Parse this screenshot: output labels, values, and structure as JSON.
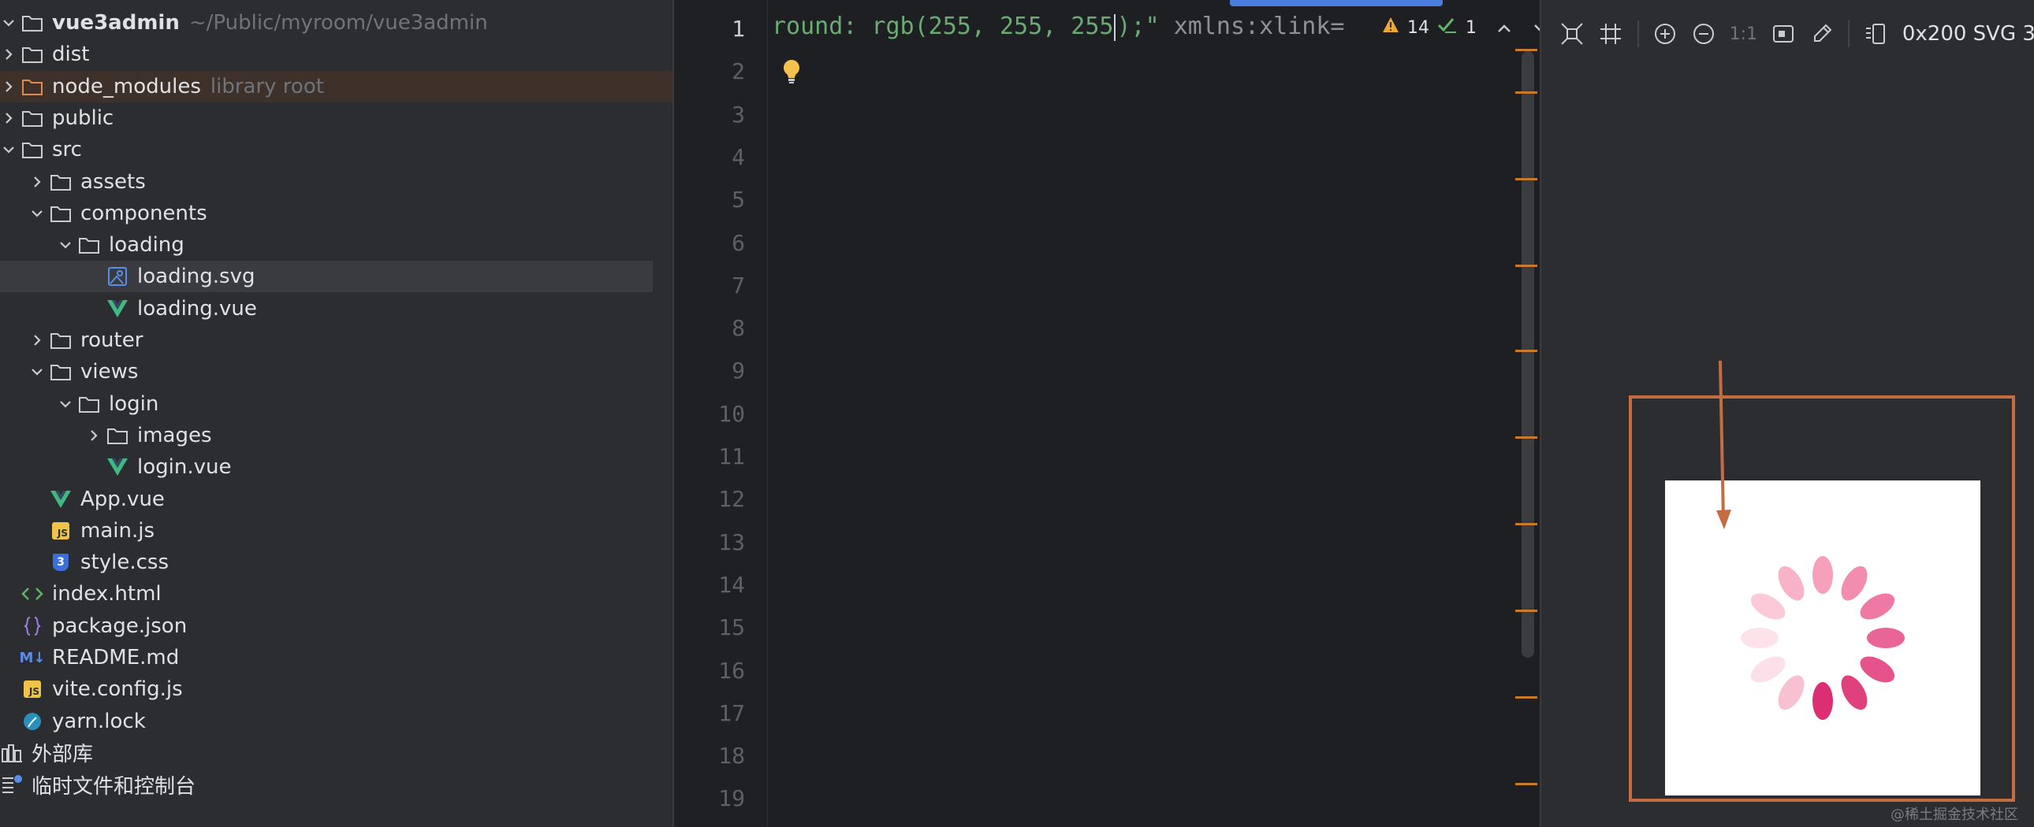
{
  "tree": {
    "items": [
      {
        "label": "vue3admin",
        "hint": "~/Public/myroom/vue3admin",
        "indent": 0,
        "icon": "folder",
        "expanded": true,
        "bold": true
      },
      {
        "label": "dist",
        "indent": 0,
        "icon": "folder",
        "expanded": false
      },
      {
        "label": "node_modules",
        "hint": "library root",
        "indent": 0,
        "icon": "folder-lib",
        "expanded": false
      },
      {
        "label": "public",
        "indent": 0,
        "icon": "folder",
        "expanded": false
      },
      {
        "label": "src",
        "indent": 0,
        "icon": "folder",
        "expanded": true
      },
      {
        "label": "assets",
        "indent": 1,
        "icon": "folder",
        "expanded": false
      },
      {
        "label": "components",
        "indent": 1,
        "icon": "folder",
        "expanded": true
      },
      {
        "label": "loading",
        "indent": 2,
        "icon": "folder",
        "expanded": true
      },
      {
        "label": "loading.svg",
        "indent": 3,
        "icon": "svg-file",
        "selected": true
      },
      {
        "label": "loading.vue",
        "indent": 3,
        "icon": "vue"
      },
      {
        "label": "router",
        "indent": 1,
        "icon": "folder",
        "expanded": false
      },
      {
        "label": "views",
        "indent": 1,
        "icon": "folder",
        "expanded": true
      },
      {
        "label": "login",
        "indent": 2,
        "icon": "folder",
        "expanded": true
      },
      {
        "label": "images",
        "indent": 3,
        "icon": "folder",
        "expanded": false
      },
      {
        "label": "login.vue",
        "indent": 3,
        "icon": "vue"
      },
      {
        "label": "App.vue",
        "indent": 1,
        "icon": "vue"
      },
      {
        "label": "main.js",
        "indent": 1,
        "icon": "js"
      },
      {
        "label": "style.css",
        "indent": 1,
        "icon": "css"
      },
      {
        "label": "index.html",
        "indent": 0,
        "icon": "html"
      },
      {
        "label": "package.json",
        "indent": 0,
        "icon": "json"
      },
      {
        "label": "README.md",
        "indent": 0,
        "icon": "md"
      },
      {
        "label": "vite.config.js",
        "indent": 0,
        "icon": "js"
      },
      {
        "label": "yarn.lock",
        "indent": 0,
        "icon": "yarn"
      },
      {
        "label": "外部库",
        "indent": -1,
        "icon": "library"
      },
      {
        "label": "临时文件和控制台",
        "indent": -1,
        "icon": "scratch"
      }
    ]
  },
  "editor": {
    "line_numbers": [
      "1",
      "2",
      "3",
      "4",
      "5",
      "6",
      "7",
      "8",
      "9",
      "10",
      "11",
      "12",
      "13",
      "14",
      "15",
      "16",
      "17",
      "18",
      "19"
    ],
    "current_line": "1",
    "code_before_caret": "round: rgb(255, 255, 255",
    "code_after_caret": ");\"",
    "code_attr": " xmlns:xlink=",
    "warnings_count": "14",
    "ok_count": "1"
  },
  "preview": {
    "size_info": "0x200 SVG 3",
    "zoom_label": "1:1",
    "spinner_colors": [
      "#fde2ea",
      "#fbc9d8",
      "#f8b3c8",
      "#f6a0bb",
      "#f28db0",
      "#ee79a4",
      "#ea6597",
      "#e5528c",
      "#e1407f",
      "#dc2f73",
      "#f8c1d2",
      "#fce0e9"
    ]
  },
  "watermark": "@稀土掘金技术社区"
}
